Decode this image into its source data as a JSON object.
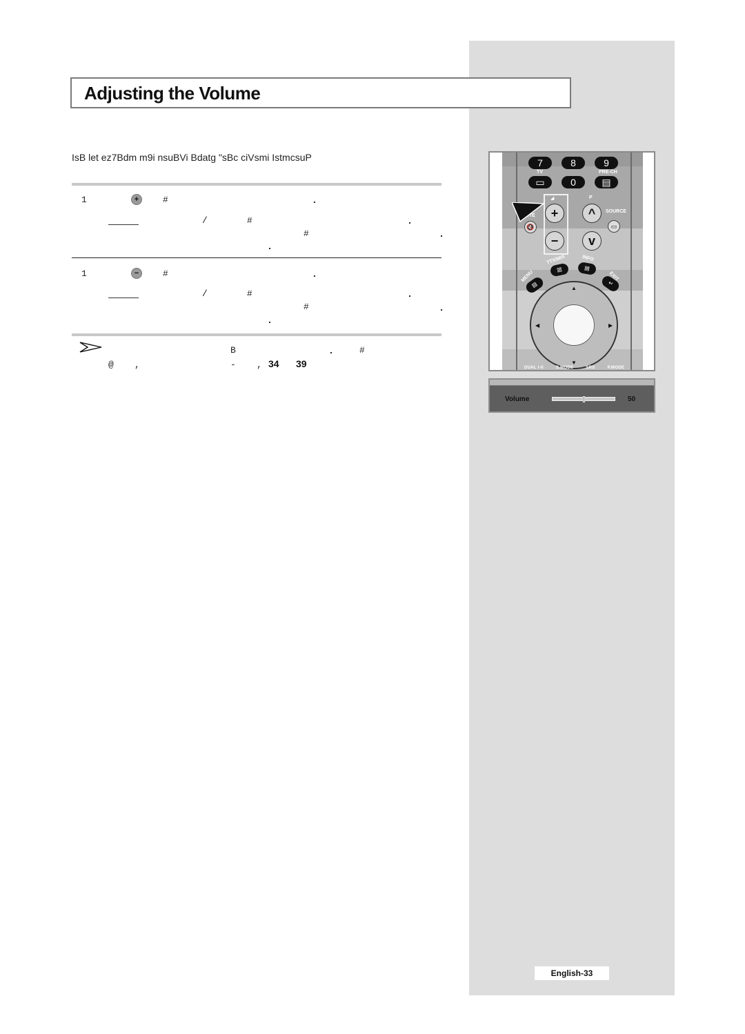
{
  "page": {
    "title": "Adjusting the Volume",
    "intro": "IsB let ez7Bdm m9i nsuBVi Bdatg \"sBc ciVsmi IstmcsuP",
    "footer": "English-33"
  },
  "steps": [
    {
      "number": "1",
      "button_icon": "volume-up-button",
      "button_glyph": "+",
      "garbled_glyphs": {
        "hash": "#",
        "slash": "/",
        "period": "."
      }
    },
    {
      "number": "1",
      "button_icon": "volume-down-button",
      "button_glyph": "−",
      "garbled_glyphs": {
        "hash": "#",
        "slash": "/",
        "period": "."
      }
    }
  ],
  "note": {
    "icon": "arrow-pointer-icon",
    "line1_glyphs": {
      "b": "B",
      "period": ".",
      "hash": "#"
    },
    "line2_glyphs": {
      "at": "@",
      "comma": ",",
      "dash": "-",
      "comma2": ","
    },
    "page_refs": [
      "34",
      "39"
    ]
  },
  "remote": {
    "number_keys": [
      "7",
      "8",
      "9",
      "0"
    ],
    "labels": {
      "tv": "TV",
      "pre_ch": "PRE-CH",
      "mute": "MUTE",
      "p": "P",
      "source": "SOURCE",
      "menu": "MENU",
      "ttx_mix": "TTX/MIX",
      "info": "INFO",
      "exit": "EXIT"
    },
    "vol_plus": "+",
    "vol_minus": "−",
    "bottom_labels": [
      "DUAL I-II",
      "S.MODE",
      "SRS",
      "P.MODE"
    ]
  },
  "osd": {
    "label": "Volume",
    "value": "50",
    "level_percent": 50
  }
}
